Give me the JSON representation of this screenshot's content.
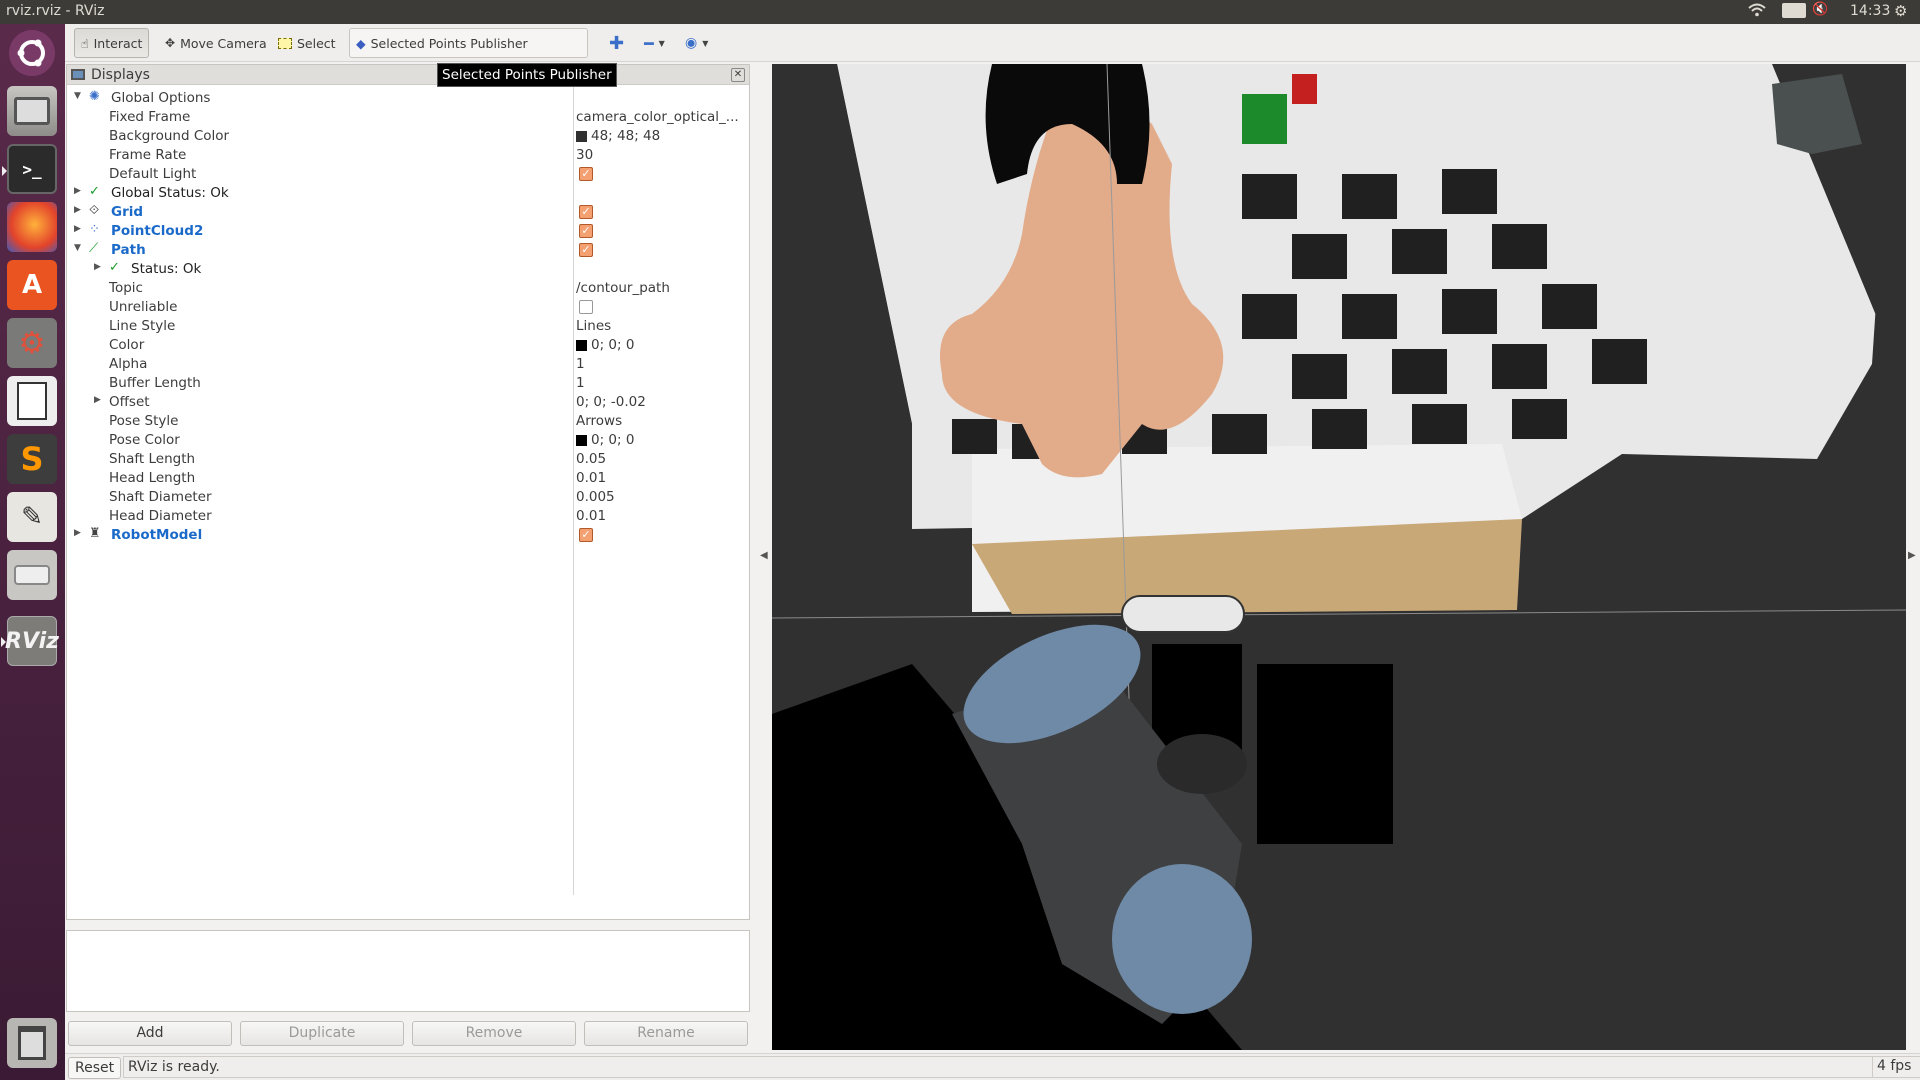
{
  "window": {
    "title": "rviz.rviz - RViz",
    "keyboard": "En",
    "clock": "14:33"
  },
  "toolbar": {
    "interact": "Interact",
    "move_camera": "Move Camera",
    "select": "Select",
    "publisher": "Selected Points Publisher",
    "tooltip": "Selected Points Publisher"
  },
  "displays": {
    "title": "Displays",
    "global_options": "Global Options",
    "fixed_frame_label": "Fixed Frame",
    "fixed_frame_value": "camera_color_optical_...",
    "bg_color_label": "Background Color",
    "bg_color_value": "48; 48; 48",
    "frame_rate_label": "Frame Rate",
    "frame_rate_value": "30",
    "default_light_label": "Default Light",
    "global_status": "Global Status: Ok",
    "grid": "Grid",
    "pointcloud": "PointCloud2",
    "path": "Path",
    "path_status": "Status: Ok",
    "topic_label": "Topic",
    "topic_value": "/contour_path",
    "unreliable_label": "Unreliable",
    "line_style_label": "Line Style",
    "line_style_value": "Lines",
    "color_label": "Color",
    "color_value": "0; 0; 0",
    "alpha_label": "Alpha",
    "alpha_value": "1",
    "buffer_label": "Buffer Length",
    "buffer_value": "1",
    "offset_label": "Offset",
    "offset_value": "0; 0; -0.02",
    "pose_style_label": "Pose Style",
    "pose_style_value": "Arrows",
    "pose_color_label": "Pose Color",
    "pose_color_value": "0; 0; 0",
    "shaft_length_label": "Shaft Length",
    "shaft_length_value": "0.05",
    "head_length_label": "Head Length",
    "head_length_value": "0.01",
    "shaft_diam_label": "Shaft Diameter",
    "shaft_diam_value": "0.005",
    "head_diam_label": "Head Diameter",
    "head_diam_value": "0.01",
    "robot_model": "RobotModel"
  },
  "buttons": {
    "add": "Add",
    "duplicate": "Duplicate",
    "remove": "Remove",
    "rename": "Rename"
  },
  "status": {
    "reset": "Reset",
    "message": "RViz is ready.",
    "fps": "4 fps"
  },
  "colors": {
    "accent_blue": "#1b6ac9",
    "checkbox": "#f4a070",
    "view_bg": "#303030",
    "launcher": "#4a2240"
  }
}
